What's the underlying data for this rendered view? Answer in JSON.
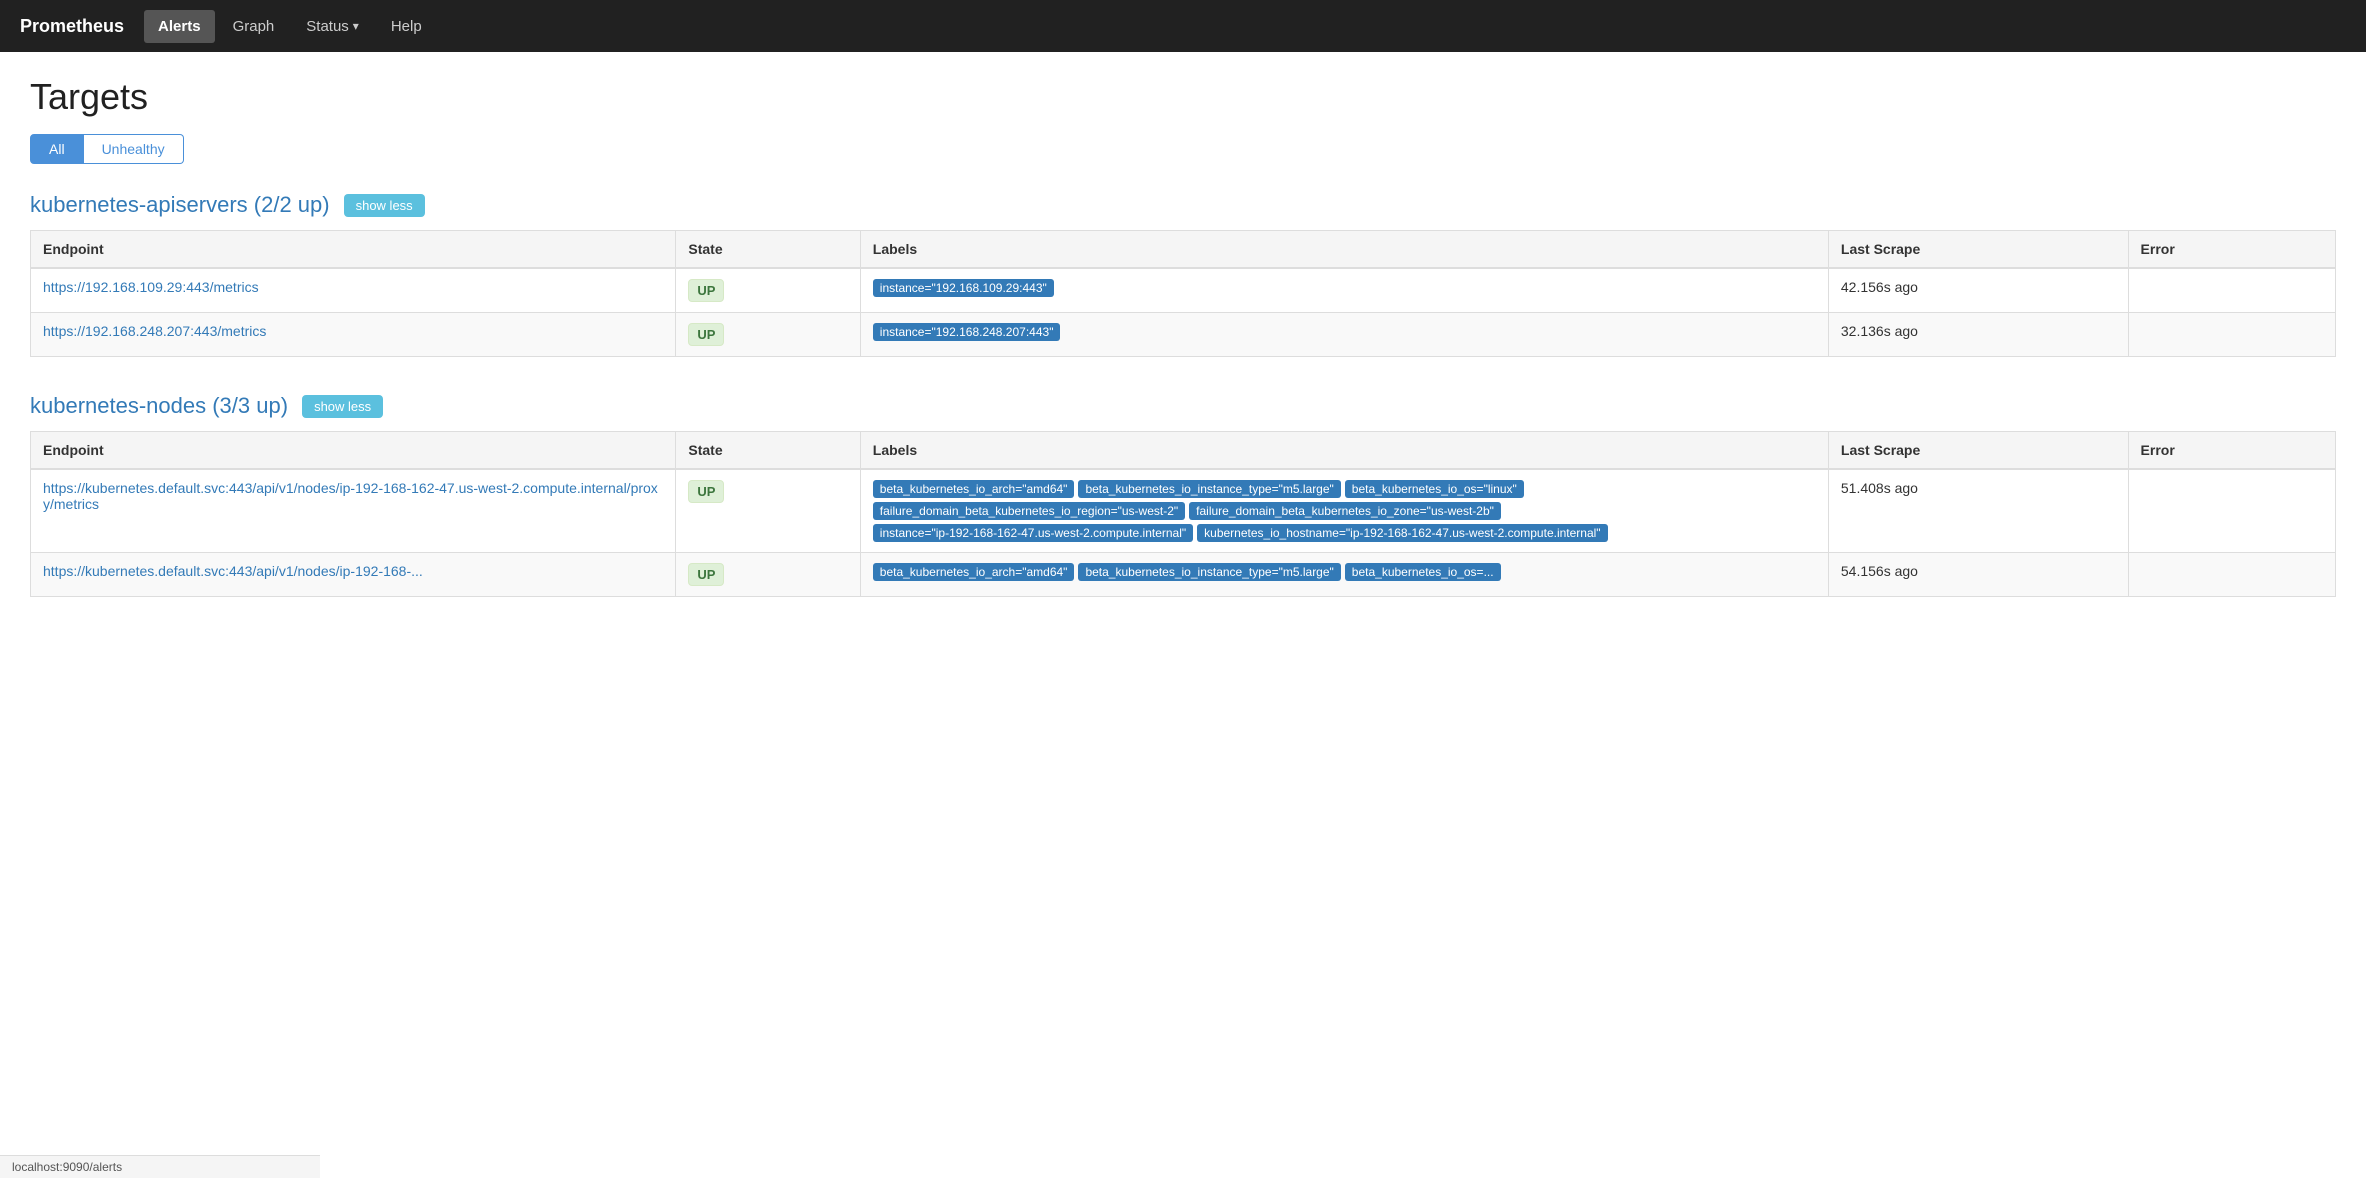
{
  "navbar": {
    "brand": "Prometheus",
    "items": [
      {
        "label": "Alerts",
        "active": false
      },
      {
        "label": "Graph",
        "active": false
      },
      {
        "label": "Status",
        "active": false,
        "dropdown": true
      },
      {
        "label": "Help",
        "active": false
      }
    ]
  },
  "page": {
    "title": "Targets",
    "filter_all": "All",
    "filter_unhealthy": "Unhealthy"
  },
  "sections": [
    {
      "id": "kubernetes-apiservers",
      "title": "kubernetes-apiservers (2/2 up)",
      "show_less_label": "show less",
      "columns": [
        "Endpoint",
        "State",
        "Labels",
        "Last Scrape",
        "Error"
      ],
      "rows": [
        {
          "endpoint": "https://192.168.109.29:443/metrics",
          "state": "UP",
          "labels": [
            "instance=\"192.168.109.29:443\""
          ],
          "last_scrape": "42.156s ago",
          "error": ""
        },
        {
          "endpoint": "https://192.168.248.207:443/metrics",
          "state": "UP",
          "labels": [
            "instance=\"192.168.248.207:443\""
          ],
          "last_scrape": "32.136s ago",
          "error": ""
        }
      ]
    },
    {
      "id": "kubernetes-nodes",
      "title": "kubernetes-nodes (3/3 up)",
      "show_less_label": "show less",
      "columns": [
        "Endpoint",
        "State",
        "Labels",
        "Last Scrape",
        "Error"
      ],
      "rows": [
        {
          "endpoint": "https://kubernetes.default.svc:443/api/v1/nodes/ip-192-168-162-47.us-west-2.compute.internal/proxy/metrics",
          "state": "UP",
          "labels": [
            "beta_kubernetes_io_arch=\"amd64\"",
            "beta_kubernetes_io_instance_type=\"m5.large\"",
            "beta_kubernetes_io_os=\"linux\"",
            "failure_domain_beta_kubernetes_io_region=\"us-west-2\"",
            "failure_domain_beta_kubernetes_io_zone=\"us-west-2b\"",
            "instance=\"ip-192-168-162-47.us-west-2.compute.internal\"",
            "kubernetes_io_hostname=\"ip-192-168-162-47.us-west-2.compute.internal\""
          ],
          "last_scrape": "51.408s ago",
          "error": ""
        },
        {
          "endpoint": "https://kubernetes.default.svc:443/api/v1/nodes/ip-192-168-...",
          "state": "UP",
          "labels": [
            "beta_kubernetes_io_arch=\"amd64\"",
            "beta_kubernetes_io_instance_type=\"m5.large\"",
            "beta_kubernetes_io_os=..."
          ],
          "last_scrape": "54.156s ago",
          "error": ""
        }
      ]
    }
  ],
  "status_bar": {
    "url": "localhost:9090/alerts"
  },
  "colors": {
    "navbar_bg": "#212121",
    "active_filter": "#4a90d9",
    "section_title": "#337ab7",
    "show_less_bg": "#5bc0de",
    "label_bg": "#337ab7",
    "state_up_bg": "#dff0d8",
    "state_up_color": "#3c763d"
  }
}
